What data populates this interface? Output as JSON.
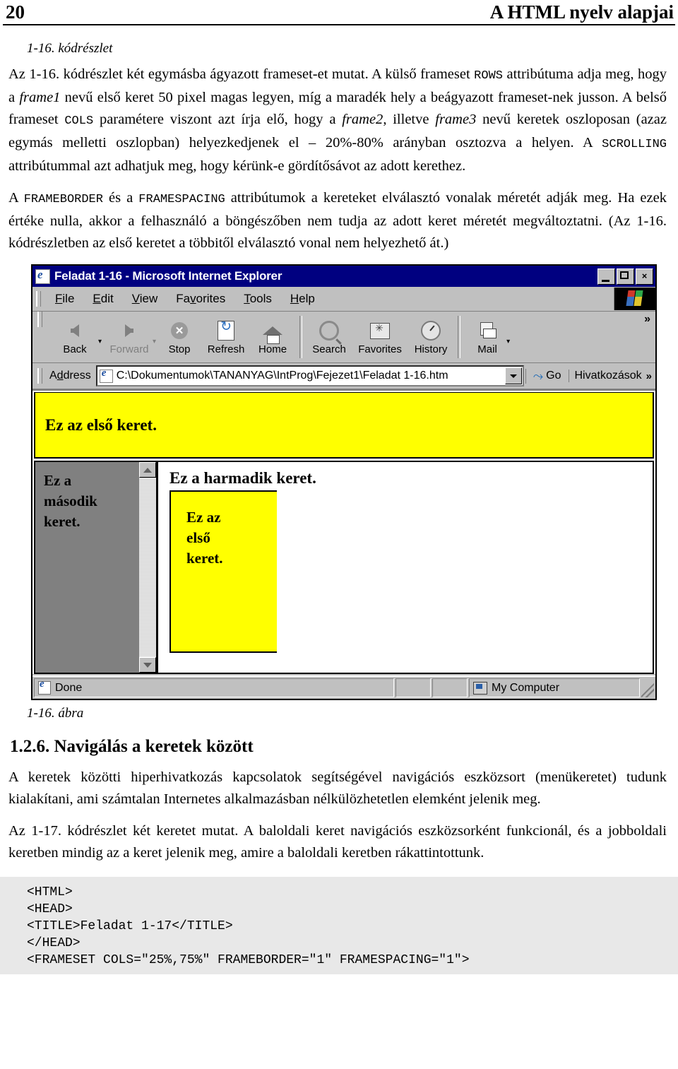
{
  "header": {
    "page_number": "20",
    "title": "A HTML nyelv alapjai"
  },
  "code_caption": "1-16. kódrészlet",
  "paragraphs": {
    "p1_a": "Az 1-16. kódrészlet két egymásba ágyazott frameset-et mutat. A külső frameset ",
    "p1_rows": "ROWS",
    "p1_b": " attribútuma adja meg, hogy a ",
    "p1_frame1": "frame1",
    "p1_c": " nevű első keret 50 pixel magas legyen, míg a maradék hely a beágyazott frameset-nek jusson. A belső frameset ",
    "p1_cols": "COLS",
    "p1_d": " paramétere viszont azt írja elő, hogy a ",
    "p1_frame2": "frame2",
    "p1_e": ", illetve ",
    "p1_frame3": "frame3",
    "p1_f": " nevű keretek oszloposan (azaz egymás melletti oszlopban) helyezkedjenek el – 20%-80% arányban osztozva a helyen. A ",
    "p1_scrolling": "SCROLLING",
    "p1_g": " attribútummal azt adhatjuk meg, hogy kérünk-e gördítősávot az adott kerethez.",
    "p2_a": "A ",
    "p2_frameborder": "FRAMEBORDER",
    "p2_b": " és a ",
    "p2_framespacing": "FRAMESPACING",
    "p2_c": " attribútumok a kereteket elválasztó vonalak méretét adják meg. Ha ezek értéke nulla, akkor a felhasználó a böngészőben nem tudja az adott keret méretét megváltoztatni. (Az 1-16. kódrészletben az első keretet a többitől elválasztó vonal nem helyezhető át.)"
  },
  "browser": {
    "title": "Feladat 1-16 - Microsoft Internet Explorer",
    "window_buttons": {
      "minimize": "minimize-button",
      "maximize": "maximize-button",
      "close": "×"
    },
    "menu": [
      {
        "label": "File",
        "accel": "F",
        "rest": "ile"
      },
      {
        "label": "Edit",
        "accel": "E",
        "rest": "dit"
      },
      {
        "label": "View",
        "accel": "V",
        "rest": "iew"
      },
      {
        "label": "Favorites",
        "pre": "Fa",
        "accel": "v",
        "rest": "orites"
      },
      {
        "label": "Tools",
        "accel": "T",
        "rest": "ools"
      },
      {
        "label": "Help",
        "accel": "H",
        "rest": "elp"
      }
    ],
    "toolbar": [
      {
        "label": "Back",
        "icon": "back-arrow-icon",
        "dim": false
      },
      {
        "label": "Forward",
        "icon": "forward-arrow-icon",
        "dim": true
      },
      {
        "label": "Stop",
        "icon": "stop-icon",
        "dim": false
      },
      {
        "label": "Refresh",
        "icon": "refresh-icon",
        "dim": false
      },
      {
        "label": "Home",
        "icon": "home-icon",
        "dim": false
      },
      {
        "label": "Search",
        "icon": "search-icon",
        "dim": false
      },
      {
        "label": "Favorites",
        "icon": "favorites-folder-icon",
        "dim": false
      },
      {
        "label": "History",
        "icon": "history-clock-icon",
        "dim": false
      },
      {
        "label": "Mail",
        "icon": "mail-icon",
        "dim": false
      }
    ],
    "toolbar_overflow": "»",
    "address": {
      "label_pre": "A",
      "label_accel": "d",
      "label_rest": "dress",
      "value": "C:\\Dokumentumok\\TANANYAG\\IntProg\\Fejezet1\\Feladat 1-16.htm",
      "go_label": "Go",
      "links_label": "Hivatkozások",
      "links_chevron": "»"
    },
    "page": {
      "frame1_text": "Ez az első keret.",
      "frame2_text": "Ez a\nmásodik\nkeret.",
      "frame3_title": "Ez a harmadik keret.",
      "frame3_nested_text": "Ez az\nelső\nkeret."
    },
    "status": {
      "text": "Done",
      "zone": "My Computer"
    }
  },
  "figure_caption": "1-16. ábra",
  "section": {
    "heading": "1.2.6. Navigálás a keretek között",
    "p1": "A keretek közötti hiperhivatkozás kapcsolatok segítségével navigációs eszközsort (menükeretet) tudunk kialakítani, ami számtalan Internetes alkalmazásban nélkülözhetetlen elemként jelenik meg.",
    "p2": "Az 1-17. kódrészlet két keretet mutat. A baloldali keret navigációs eszközsorként funkcionál, és a jobboldali keretben mindig az a keret jelenik meg, amire a baloldali keretben rákattintottunk."
  },
  "code_block": "<HTML>\n<HEAD>\n<TITLE>Feladat 1-17</TITLE>\n</HEAD>\n<FRAMESET COLS=\"25%,75%\" FRAMEBORDER=\"1\" FRAMESPACING=\"1\">",
  "colors": {
    "titlebar": "#000080",
    "chrome": "#c0c0c0",
    "frame_yellow": "#ffff00",
    "frame_gray": "#808080",
    "code_bg": "#e8e8e8"
  }
}
